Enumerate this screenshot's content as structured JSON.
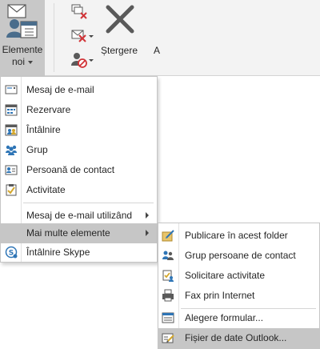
{
  "ribbon": {
    "new_items_line1": "Elemente",
    "new_items_line2": "noi",
    "delete_label": "Ștergere",
    "cut_label": "A"
  },
  "main_menu": {
    "items": [
      {
        "label": "Mesaj de e-mail",
        "icon": "envelope-icon"
      },
      {
        "label": "Rezervare",
        "icon": "calendar-icon"
      },
      {
        "label": "Întâlnire",
        "icon": "meeting-icon"
      },
      {
        "label": "Grup",
        "icon": "group-icon"
      },
      {
        "label": "Persoană de contact",
        "icon": "contact-card-icon"
      },
      {
        "label": "Activitate",
        "icon": "task-icon"
      },
      {
        "label": "Mesaj de e-mail utilizând",
        "submenu": true
      },
      {
        "label": "Mai multe elemente",
        "submenu": true,
        "highlighted": true
      },
      {
        "label": "Întâlnire Skype",
        "icon": "skype-icon"
      }
    ]
  },
  "sub_menu": {
    "items": [
      {
        "label": "Publicare în acest folder",
        "icon": "post-icon"
      },
      {
        "label": "Grup persoane de contact",
        "icon": "contact-group-icon"
      },
      {
        "label": "Solicitare activitate",
        "icon": "task-request-icon"
      },
      {
        "label": "Fax prin Internet",
        "icon": "fax-icon"
      },
      {
        "label": "Alegere formular...",
        "icon": "form-icon"
      },
      {
        "label": "Fișier de date Outlook...",
        "icon": "data-file-icon",
        "highlighted": true
      }
    ]
  },
  "colors": {
    "ribbon_bg": "#f3f3f3",
    "button_pressed": "#c8c8c8",
    "highlight": "#c6c6c6",
    "icon_blue": "#2e75b6",
    "icon_red": "#d13438"
  }
}
